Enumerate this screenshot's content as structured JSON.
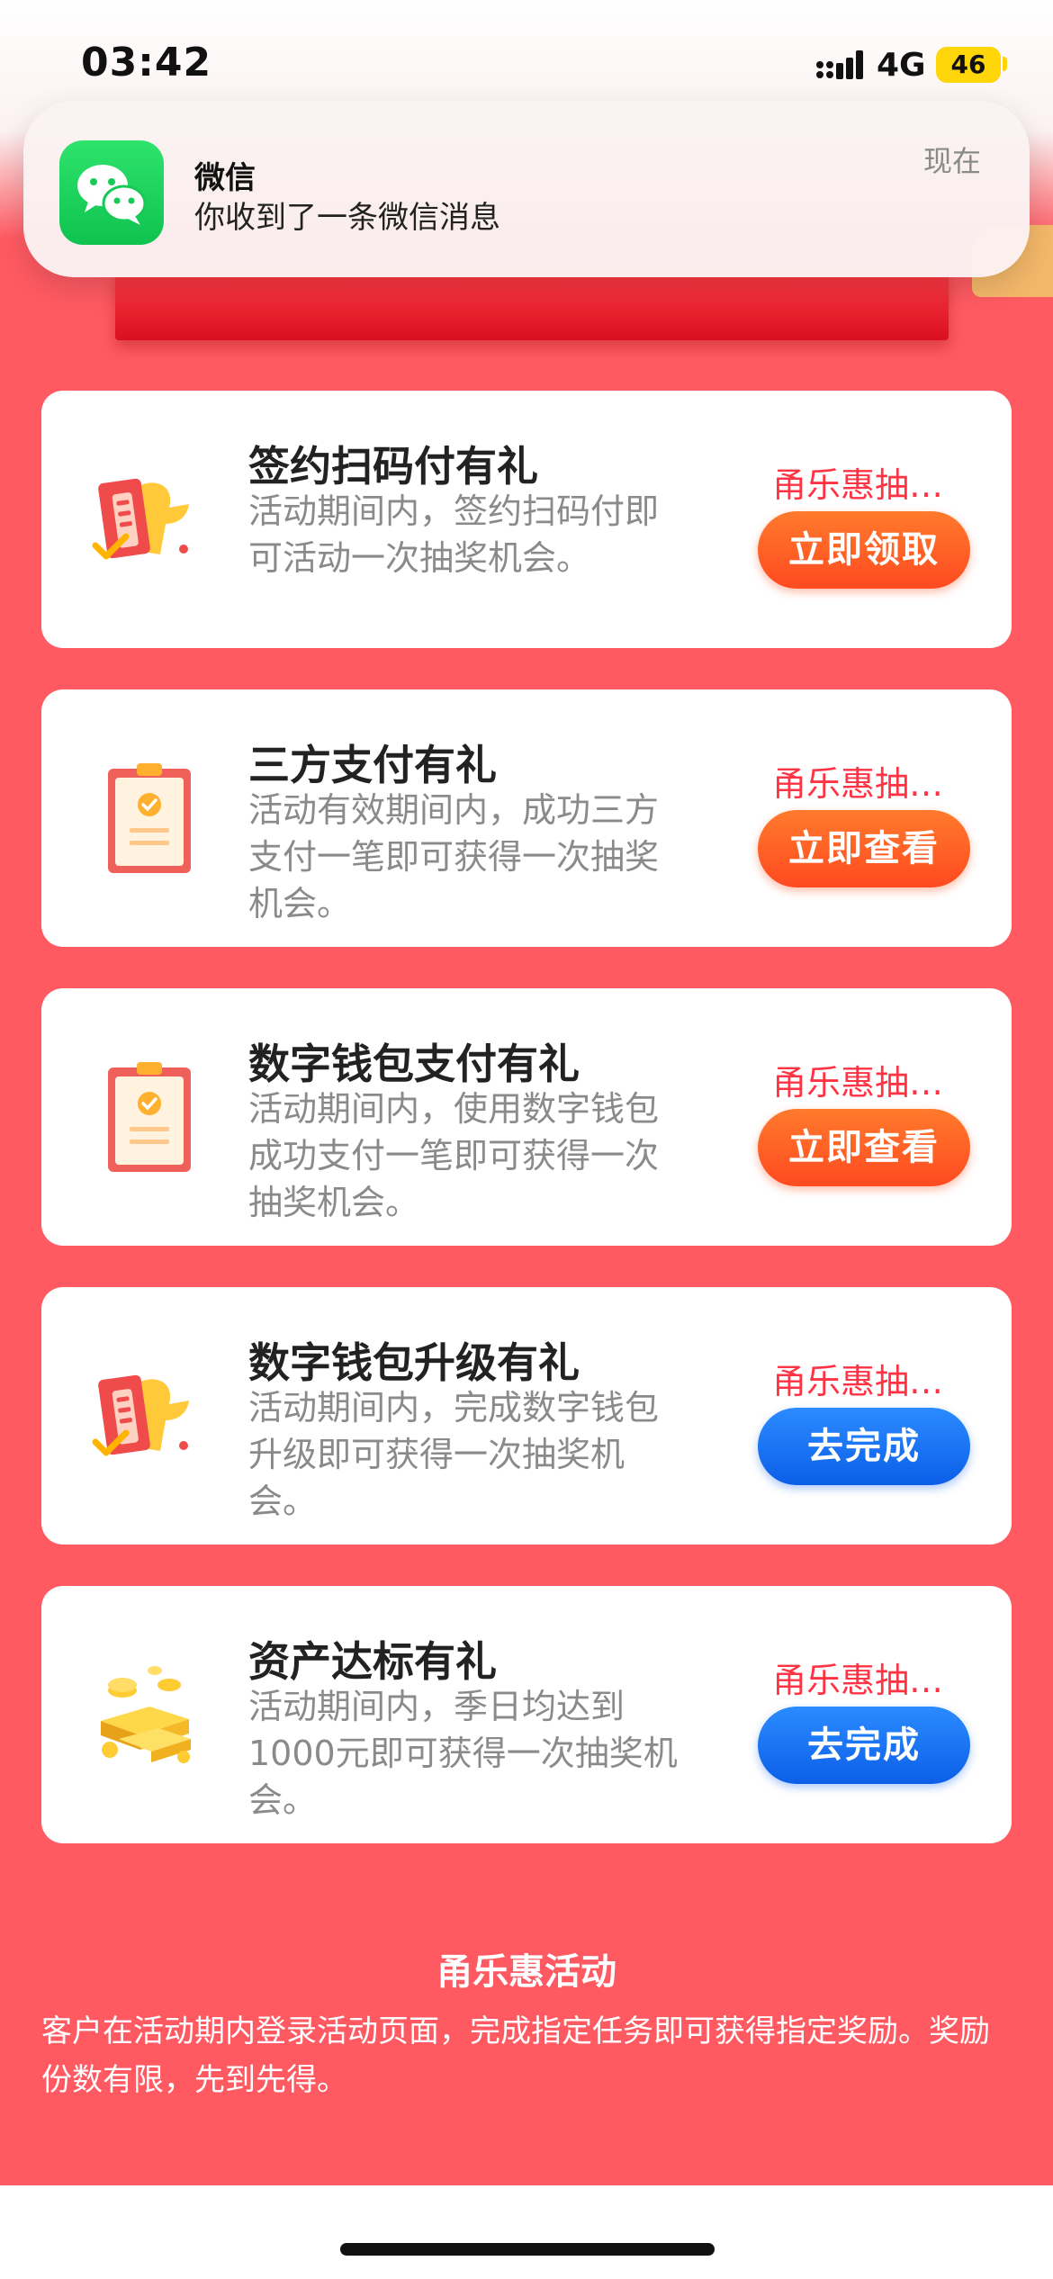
{
  "status_bar": {
    "time": "03:42",
    "network": "4G",
    "battery": "46",
    "battery_color": "#ffd60a"
  },
  "notification": {
    "app_name": "微信",
    "message": "你收到了一条微信消息",
    "time": "现在",
    "icon": "wechat-icon"
  },
  "tasks": [
    {
      "title": "签约扫码付有礼",
      "description": "活动期间内，签约扫码付即可活动一次抽奖机会。",
      "tag": "甬乐惠抽…",
      "button": "立即领取",
      "button_color": "orange",
      "icon": "receipt-check-icon"
    },
    {
      "title": "三方支付有礼",
      "description": "活动有效期间内，成功三方支付一笔即可获得一次抽奖机会。",
      "tag": "甬乐惠抽…",
      "button": "立即查看",
      "button_color": "orange",
      "icon": "clipboard-check-icon"
    },
    {
      "title": "数字钱包支付有礼",
      "description": "活动期间内，使用数字钱包成功支付一笔即可获得一次抽奖机会。",
      "tag": "甬乐惠抽…",
      "button": "立即查看",
      "button_color": "orange",
      "icon": "clipboard-check-icon"
    },
    {
      "title": "数字钱包升级有礼",
      "description": "活动期间内，完成数字钱包升级即可获得一次抽奖机会。",
      "tag": "甬乐惠抽…",
      "button": "去完成",
      "button_color": "blue",
      "icon": "receipt-check-icon"
    },
    {
      "title": "资产达标有礼",
      "description": "活动期间内，季日均达到1000元即可获得一次抽奖机会。",
      "tag": "甬乐惠抽…",
      "button": "去完成",
      "button_color": "blue",
      "icon": "gold-coins-icon"
    }
  ],
  "footer": {
    "title": "甬乐惠活动",
    "description": "客户在活动期内登录活动页面，完成指定任务即可获得指定奖励。奖励份数有限，先到先得。"
  },
  "colors": {
    "page_background": "#ff5a62",
    "tag": "#ff3344",
    "button_orange": "#ff5a24",
    "button_blue": "#1570f0"
  }
}
